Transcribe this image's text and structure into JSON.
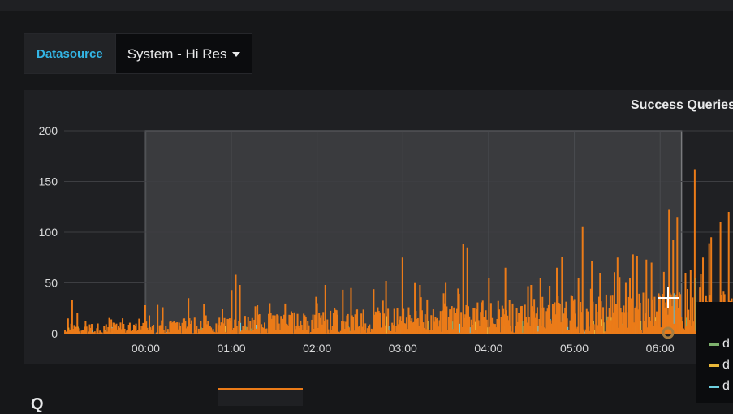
{
  "variables": {
    "datasource_label": "Datasource",
    "datasource_value": "System - Hi Res"
  },
  "panel": {
    "title": "Success Queries"
  },
  "chart_data": {
    "type": "bar",
    "title": "Success Queries",
    "ylim": [
      0,
      200
    ],
    "y_ticks": [
      0,
      50,
      100,
      150,
      200
    ],
    "x_ticks": [
      "00:00",
      "01:00",
      "02:00",
      "03:00",
      "04:00",
      "05:00",
      "06:00"
    ],
    "x_range_hours": [
      -0.95,
      6.85
    ],
    "grid": true,
    "selection_hours": [
      0.0,
      6.25
    ],
    "colors": [
      "#eb7b18",
      "#eab839",
      "#6ed0e0",
      "#7eb26d"
    ],
    "series": [
      {
        "peaks_hours": [
          -0.9,
          -0.85,
          -0.8,
          -0.7,
          -0.55,
          -0.4,
          0.0,
          0.05,
          0.2,
          0.45,
          0.5,
          0.7,
          0.9,
          1.0,
          1.05,
          1.1,
          1.3,
          1.45,
          1.55,
          1.7,
          2.0,
          2.1,
          2.4,
          2.8,
          3.0,
          3.2,
          3.5,
          3.7,
          3.75,
          4.0,
          4.2,
          4.5,
          4.6,
          4.8,
          5.1,
          5.2,
          5.3,
          5.5,
          5.6,
          5.9,
          6.1,
          6.15,
          6.2,
          6.3,
          6.4,
          6.5,
          6.6,
          6.7,
          6.8
        ],
        "peaks_values": [
          15,
          33,
          20,
          12,
          10,
          14,
          28,
          18,
          26,
          15,
          35,
          18,
          24,
          43,
          58,
          48,
          28,
          30,
          18,
          22,
          30,
          48,
          45,
          52,
          75,
          48,
          50,
          88,
          85,
          55,
          65,
          48,
          55,
          65,
          105,
          72,
          60,
          75,
          50,
          70,
          122,
          92,
          115,
          60,
          162,
          75,
          95,
          110,
          120
        ]
      }
    ]
  },
  "legend": {
    "items": [
      {
        "label": "d",
        "color": "#7eb26d"
      },
      {
        "label": "d",
        "color": "#eab839"
      },
      {
        "label": "d",
        "color": "#6ed0e0"
      }
    ]
  },
  "section": {
    "title": "Q"
  }
}
